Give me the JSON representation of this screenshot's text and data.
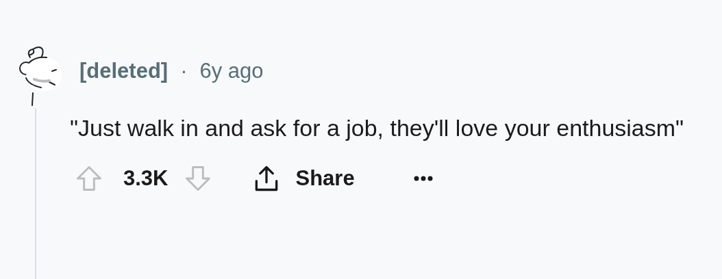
{
  "comment": {
    "author": "[deleted]",
    "separator": "·",
    "time": "6y ago",
    "body": "\"Just walk in and ask for a job, they'll love your enthusiasm\"",
    "score": "3.3K",
    "share_label": "Share"
  }
}
